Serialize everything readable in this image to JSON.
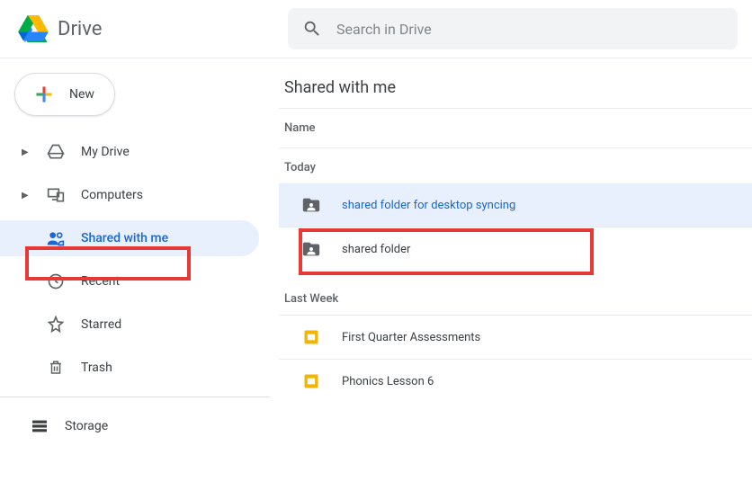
{
  "product": {
    "name": "Drive"
  },
  "search": {
    "placeholder": "Search in Drive"
  },
  "new_button": {
    "label": "New"
  },
  "sidebar": {
    "items": [
      {
        "label": "My Drive"
      },
      {
        "label": "Computers"
      },
      {
        "label": "Shared with me"
      },
      {
        "label": "Recent"
      },
      {
        "label": "Starred"
      },
      {
        "label": "Trash"
      }
    ],
    "storage": {
      "label": "Storage"
    }
  },
  "content": {
    "title": "Shared with me",
    "column_header": "Name",
    "groups": [
      {
        "label": "Today",
        "items": [
          {
            "icon": "shared-folder",
            "name": "shared folder for desktop syncing",
            "selected": true
          },
          {
            "icon": "shared-folder",
            "name": "shared folder",
            "selected": false
          }
        ]
      },
      {
        "label": "Last Week",
        "items": [
          {
            "icon": "slides",
            "name": "First Quarter Assessments",
            "selected": false
          },
          {
            "icon": "slides",
            "name": "Phonics Lesson 6",
            "selected": false
          }
        ]
      }
    ]
  }
}
